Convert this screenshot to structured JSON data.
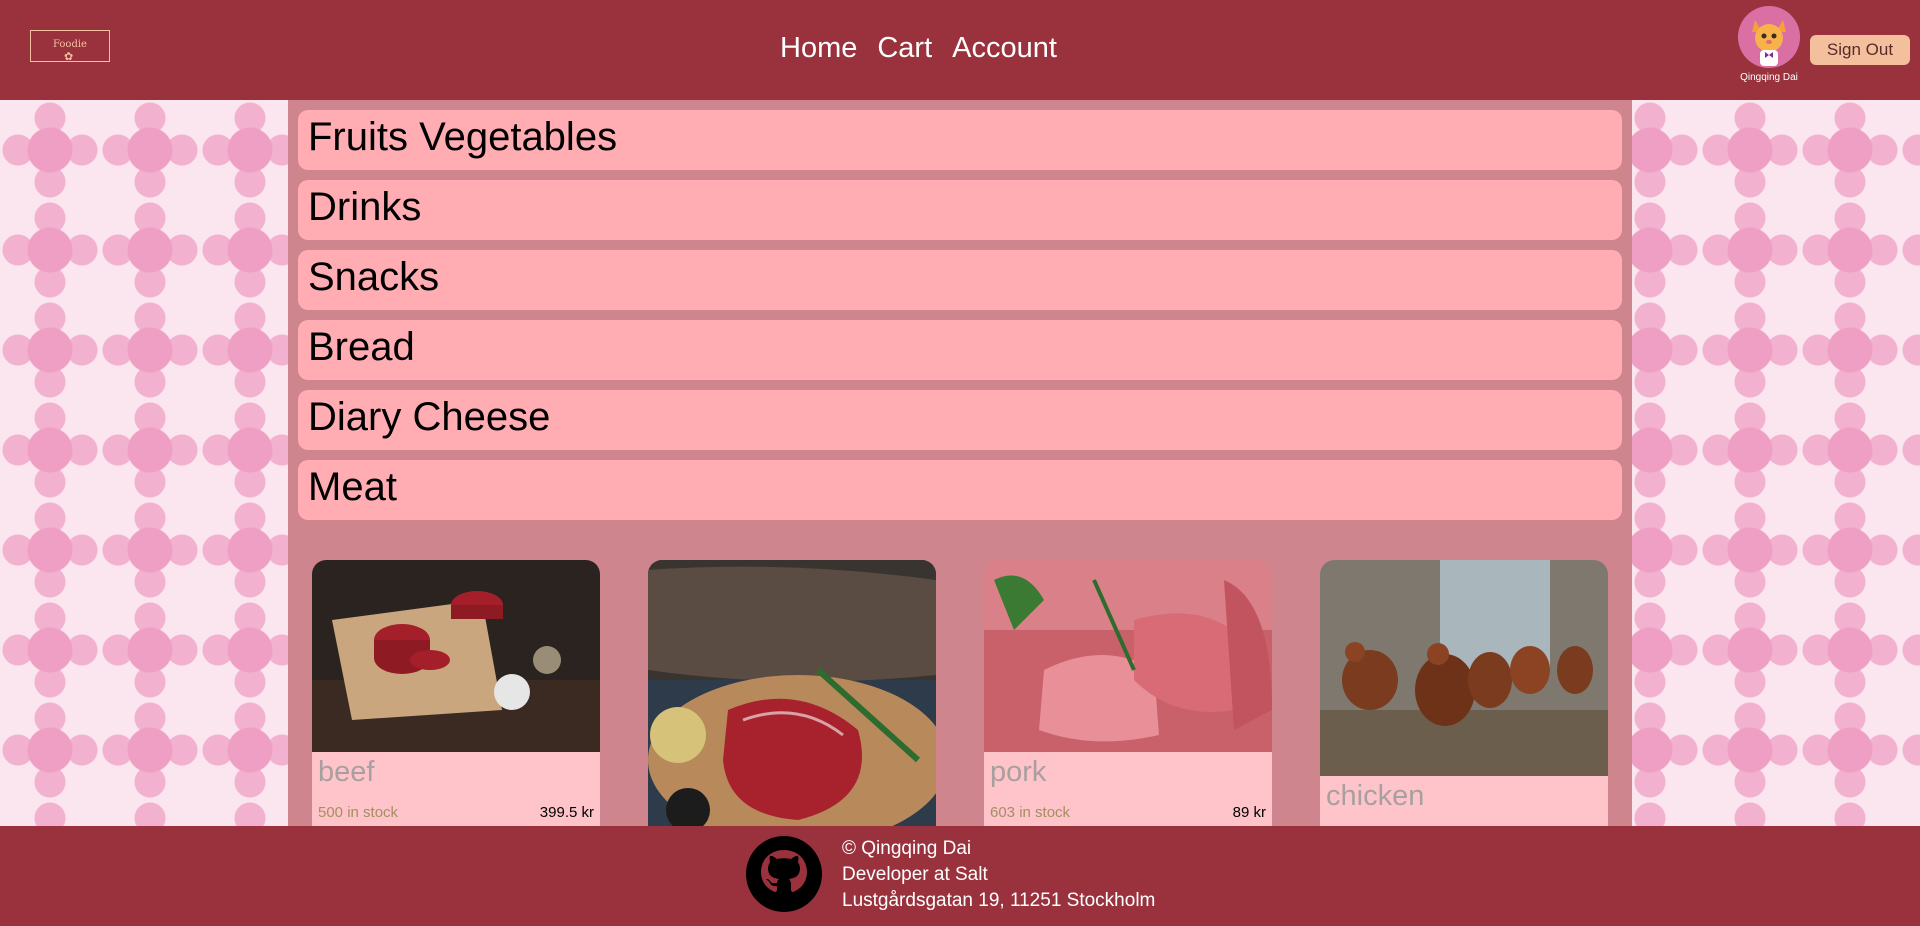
{
  "header": {
    "logo_text": "Foodie",
    "nav": [
      "Home",
      "Cart",
      "Account"
    ],
    "user_name": "Qingqing Dai",
    "sign_out_label": "Sign Out"
  },
  "categories": [
    "Fruits Vegetables",
    "Drinks",
    "Snacks",
    "Bread",
    "Diary Cheese",
    "Meat"
  ],
  "products": [
    {
      "name": "beef",
      "stock": "500 in stock",
      "price": "399.5 kr",
      "image": "raw-beef-steaks-photo"
    },
    {
      "name": "",
      "stock": "",
      "price": "",
      "image": "steak-on-board-photo"
    },
    {
      "name": "pork",
      "stock": "603 in stock",
      "price": "89 kr",
      "image": "raw-pork-photo"
    },
    {
      "name": "chicken",
      "stock": "",
      "price": "",
      "image": "chickens-photo"
    }
  ],
  "footer": {
    "copyright": "© Qingqing Dai",
    "role": "Developer at Salt",
    "address": "Lustgårdsgatan 19, 11251 Stockholm",
    "icon": "github-icon"
  },
  "colors": {
    "header_bg": "#9a323d",
    "main_bg": "#cf858d",
    "category_bg": "#ffadb3",
    "card_bg": "#ffc4c9",
    "sign_out_bg": "#f4bf9c"
  }
}
